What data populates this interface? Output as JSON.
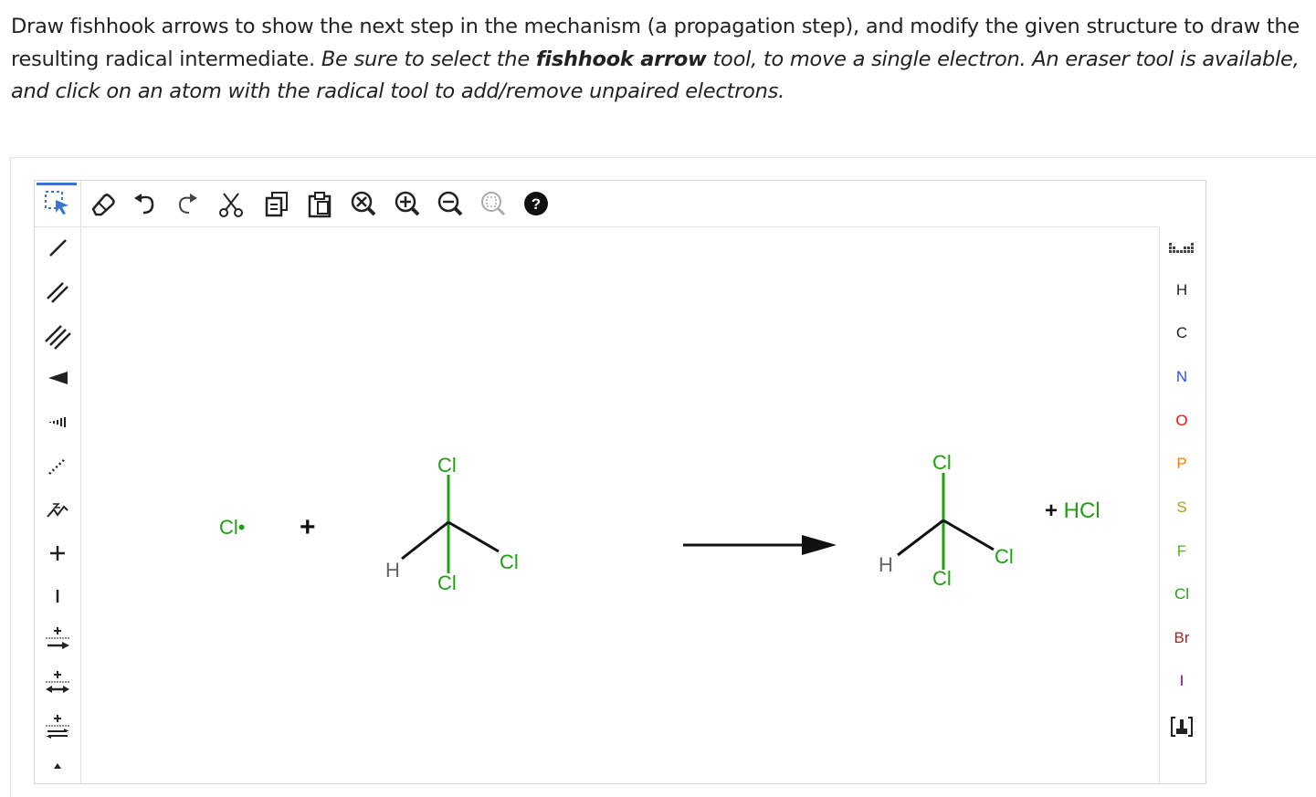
{
  "instructions": {
    "part1": "Draw fishhook arrows to show the next step in the mechanism (a propagation step), and modify the given structure to draw the resulting radical intermediate. ",
    "part2": "Be sure to select the ",
    "part3": "fishhook arrow",
    "part4": " tool, to move a single electron. An eraser tool is available, and click on an atom with the radical tool to add/remove unpaired electrons."
  },
  "toolbar": {
    "tools": [
      "select",
      "eraser",
      "undo",
      "redo",
      "cut",
      "copy",
      "paste",
      "clear",
      "zoom-in",
      "zoom-out",
      "zoom-fit",
      "help"
    ],
    "help_label": "?"
  },
  "left_tools": [
    "single-bond",
    "double-bond",
    "triple-bond",
    "wedge-bond",
    "hash-bond",
    "dashed-bond",
    "chain",
    "positive-charge",
    "negative-charge",
    "reaction-arrow",
    "equilibrium-arrow",
    "resonance-arrow",
    "fishhook-arrow"
  ],
  "elements": {
    "H": "H",
    "C": "C",
    "N": "N",
    "O": "O",
    "P": "P",
    "S": "S",
    "F": "F",
    "Cl": "Cl",
    "Br": "Br",
    "I": "I"
  },
  "colors": {
    "N": "#3050F8",
    "O": "#FF0D0D",
    "P": "#FF8000",
    "S": "#B0A010",
    "F": "#55B020",
    "Cl": "#1FA010",
    "Br": "#A62929",
    "I": "#940094",
    "accent": "#3b74d4"
  },
  "scheme": {
    "radical_label": "Cl•",
    "plus1": "+",
    "reactant": {
      "top": "Cl",
      "right": "Cl",
      "bottom": "Cl",
      "left": "H"
    },
    "product": {
      "top": "Cl",
      "right": "Cl",
      "bottom": "Cl",
      "left": "H"
    },
    "byproduct": "+ HCl"
  }
}
